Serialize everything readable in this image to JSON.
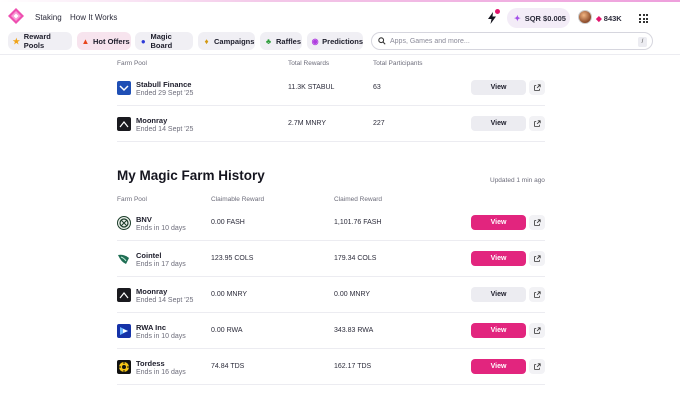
{
  "header": {
    "nav": [
      "Staking",
      "How It Works"
    ],
    "sqr_price": "SQR $0.005",
    "points": "843K"
  },
  "categories": [
    {
      "label": "Reward Pools",
      "icon": "star-icon",
      "active": false
    },
    {
      "label": "Hot Offers",
      "icon": "fire-icon",
      "active": true
    },
    {
      "label": "Magic Board",
      "icon": "magic-ball-icon",
      "active": false
    },
    {
      "label": "Campaigns",
      "icon": "trophy-icon",
      "active": false
    },
    {
      "label": "Raffles",
      "icon": "clover-icon",
      "active": false
    },
    {
      "label": "Predictions",
      "icon": "crystal-icon",
      "active": false
    }
  ],
  "search": {
    "placeholder": "Apps, Games and more...",
    "shortcut": "/"
  },
  "past_pools": {
    "columns": [
      "Farm Pool",
      "Total Rewards",
      "Total Participants"
    ],
    "rows": [
      {
        "name": "Stabull Finance",
        "status": "Ended 29 Sept '25",
        "rewards": "11.3K STABUL",
        "participants": "63",
        "action": "View",
        "icon": "stabull-icon"
      },
      {
        "name": "Moonray",
        "status": "Ended 14 Sept '25",
        "rewards": "2.7M MNRY",
        "participants": "227",
        "action": "View",
        "icon": "moonray-icon"
      }
    ]
  },
  "history": {
    "title": "My Magic Farm History",
    "updated": "Updated 1 min ago",
    "columns": [
      "Farm Pool",
      "Claimable Reward",
      "Claimed Reward"
    ],
    "rows": [
      {
        "name": "BNV",
        "status": "Ends in 10 days",
        "claimable": "0.00 FASH",
        "claimed": "1,101.76 FASH",
        "action": "View",
        "primary": true,
        "icon": "bnv-icon"
      },
      {
        "name": "Cointel",
        "status": "Ends in 17 days",
        "claimable": "123.95 COLS",
        "claimed": "179.34 COLS",
        "action": "View",
        "primary": true,
        "icon": "cointel-icon"
      },
      {
        "name": "Moonray",
        "status": "Ended 14 Sept '25",
        "claimable": "0.00 MNRY",
        "claimed": "0.00 MNRY",
        "action": "View",
        "primary": false,
        "icon": "moonray-icon"
      },
      {
        "name": "RWA Inc",
        "status": "Ends in 10 days",
        "claimable": "0.00 RWA",
        "claimed": "343.83 RWA",
        "action": "View",
        "primary": true,
        "icon": "rwa-icon"
      },
      {
        "name": "Tordess",
        "status": "Ends in 16 days",
        "claimable": "74.84 TDS",
        "claimed": "162.17 TDS",
        "action": "View",
        "primary": true,
        "icon": "tordess-icon"
      }
    ]
  },
  "colors": {
    "accent": "#e2257e",
    "pill_bg": "#f0eff4",
    "active_pill_bg": "#f7e4ee"
  }
}
